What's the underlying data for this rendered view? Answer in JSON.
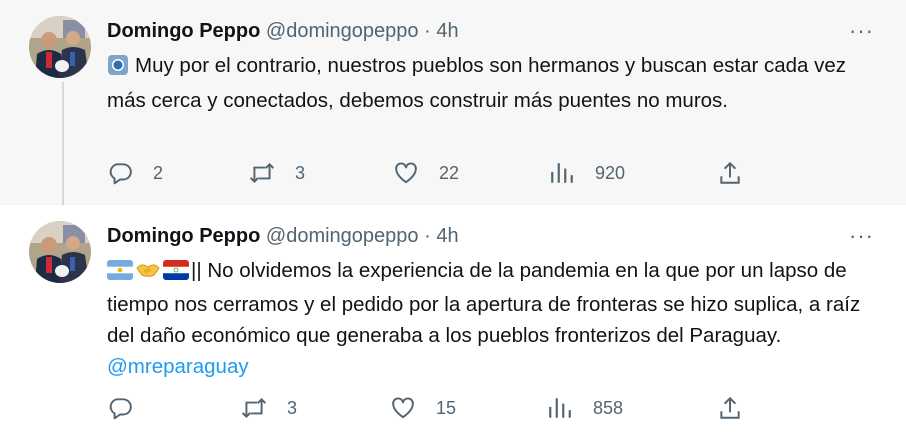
{
  "tweets": [
    {
      "author_name": "Domingo Peppo",
      "handle": "@domingopeppo",
      "separator": "·",
      "time": "4h",
      "more_label": "···",
      "text": "Muy por el contrario, nuestros pueblos son hermanos y buscan estar cada vez más cerca y conectados, debemos construir más puentes no muros.",
      "leading_icon": "blue-circle-icon",
      "counts": {
        "replies": "2",
        "retweets": "3",
        "likes": "22",
        "views": "920"
      }
    },
    {
      "author_name": "Domingo Peppo",
      "handle": "@domingopeppo",
      "separator": "·",
      "time": "4h",
      "more_label": "···",
      "text_prefix": "|| No olvidemos la experiencia de la pandemia en la que por un lapso de tiempo nos cerramos y el pedido por la apertura de fronteras se hizo suplica, a raíz del daño económico que generaba a los pueblos fronterizos del Paraguay. ",
      "mention": "@mreparaguay",
      "leading_icons": [
        "argentina-flag-icon",
        "handshake-icon",
        "paraguay-flag-icon"
      ],
      "counts": {
        "replies": "",
        "retweets": "3",
        "likes": "15",
        "views": "858"
      }
    }
  ],
  "colors": {
    "link": "#1d9bf0",
    "muted": "#536471",
    "text": "#0f1419"
  }
}
